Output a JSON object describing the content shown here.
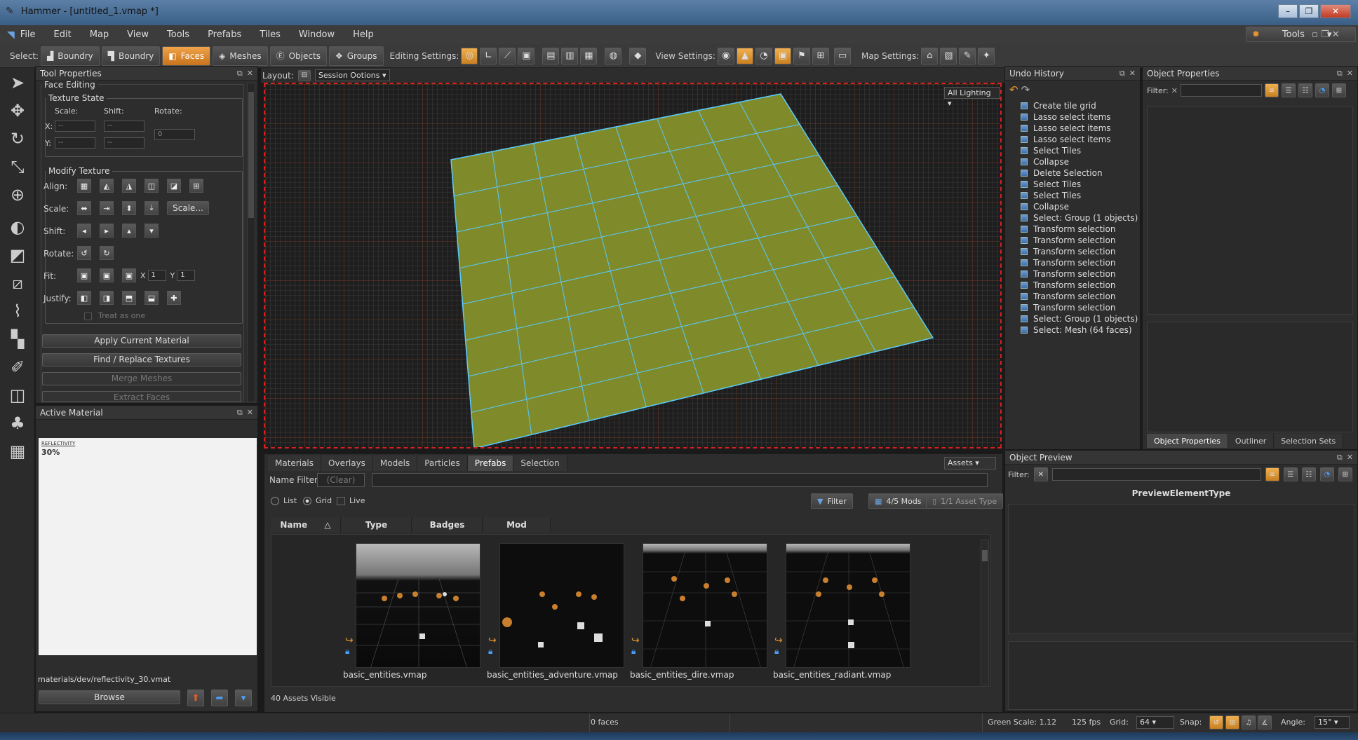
{
  "window": {
    "title": "Hammer - [untitled_1.vmap *]",
    "buttons": [
      "–",
      "❐",
      "✕"
    ]
  },
  "menu": [
    "File",
    "Edit",
    "Map",
    "View",
    "Tools",
    "Prefabs",
    "Tiles",
    "Window",
    "Help"
  ],
  "tools_button": "Tools",
  "toolbar": {
    "select_label": "Select:",
    "modes": [
      "Boundry",
      "Boundry",
      "Faces",
      "Meshes",
      "Objects",
      "Groups"
    ],
    "editing_settings": "Editing Settings:",
    "view_settings": "View Settings:",
    "map_settings": "Map Settings:"
  },
  "tool_properties": {
    "title": "Tool Properties",
    "face_editing": "Face Editing",
    "texture_state": "Texture State",
    "scale": "Scale:",
    "shift": "Shift:",
    "rotate": "Rotate:",
    "x": "X:",
    "y": "Y:",
    "dash": "--",
    "rotate_value": "0",
    "modify_texture": "Modify Texture",
    "align": "Align:",
    "scale_row": "Scale:",
    "scale_btn": "Scale...",
    "shift_row": "Shift:",
    "rotate_row": "Rotate:",
    "fit": "Fit:",
    "fit_x": "X",
    "fit_y": "Y",
    "fit_x_val": "1",
    "fit_y_val": "1",
    "justify": "Justify:",
    "treat_as_one": "Treat as one",
    "apply_material": "Apply Current Material",
    "find_replace": "Find / Replace Textures",
    "merge_meshes": "Merge Meshes",
    "extract_faces": "Extract Faces"
  },
  "active_material": {
    "title": "Active Material",
    "swatch_title": "REFLECTIVITY",
    "swatch_value": "30%",
    "path": "materials/dev/reflectivity_30.vmat",
    "browse": "Browse"
  },
  "viewport": {
    "layout": "Layout:",
    "session": "Session Ootions",
    "lighting": "All Lighting"
  },
  "assets": {
    "tabs": [
      "Materials",
      "Overlays",
      "Models",
      "Particles",
      "Prefabs",
      "Selection"
    ],
    "active_tab": "Prefabs",
    "assets_btn": "Assets",
    "name_filter": "Name Filter:",
    "clear": "(Clear)",
    "list": "List",
    "grid": "Grid",
    "live": "Live",
    "filter": "Filter",
    "mods": "4/5 Mods",
    "asset_type": "1/1 Asset Type",
    "columns": [
      "Name",
      "Type",
      "Badges",
      "Mod"
    ],
    "items": [
      "basic_entities.vmap",
      "basic_entities_adventure.vmap",
      "basic_entities_dire.vmap",
      "basic_entities_radiant.vmap"
    ],
    "count": "40 Assets Visible"
  },
  "undo_history": {
    "title": "Undo History",
    "items": [
      "Create tile grid",
      "Lasso select items",
      "Lasso select items",
      "Lasso select items",
      "Select Tiles",
      "Collapse",
      "Delete Selection",
      "Select Tiles",
      "Select Tiles",
      "Collapse",
      "Select: Group (1 objects)",
      "Transform selection",
      "Transform selection",
      "Transform selection",
      "Transform selection",
      "Transform selection",
      "Transform selection",
      "Transform selection",
      "Transform selection",
      "Select: Group (1 objects)",
      "Select: Mesh (64 faces)"
    ]
  },
  "object_properties": {
    "title": "Object Properties",
    "filter": "Filter:",
    "tabs": [
      "Object Properties",
      "Outliner",
      "Selection Sets"
    ]
  },
  "object_preview": {
    "title": "Object Preview",
    "filter": "Filter:",
    "type": "PreviewElementType"
  },
  "status": {
    "faces": "0 faces",
    "green_scale": "Green Scale: 1.12",
    "fps": "125 fps",
    "grid_label": "Grid:",
    "grid_value": "64",
    "snap_label": "Snap:",
    "angle_label": "Angle:",
    "angle_value": "15°"
  },
  "colors": {
    "accent": "#e8962f",
    "selection": "#d62020",
    "floor": "#7d8a2a",
    "grid_edge": "#58c8ff"
  }
}
